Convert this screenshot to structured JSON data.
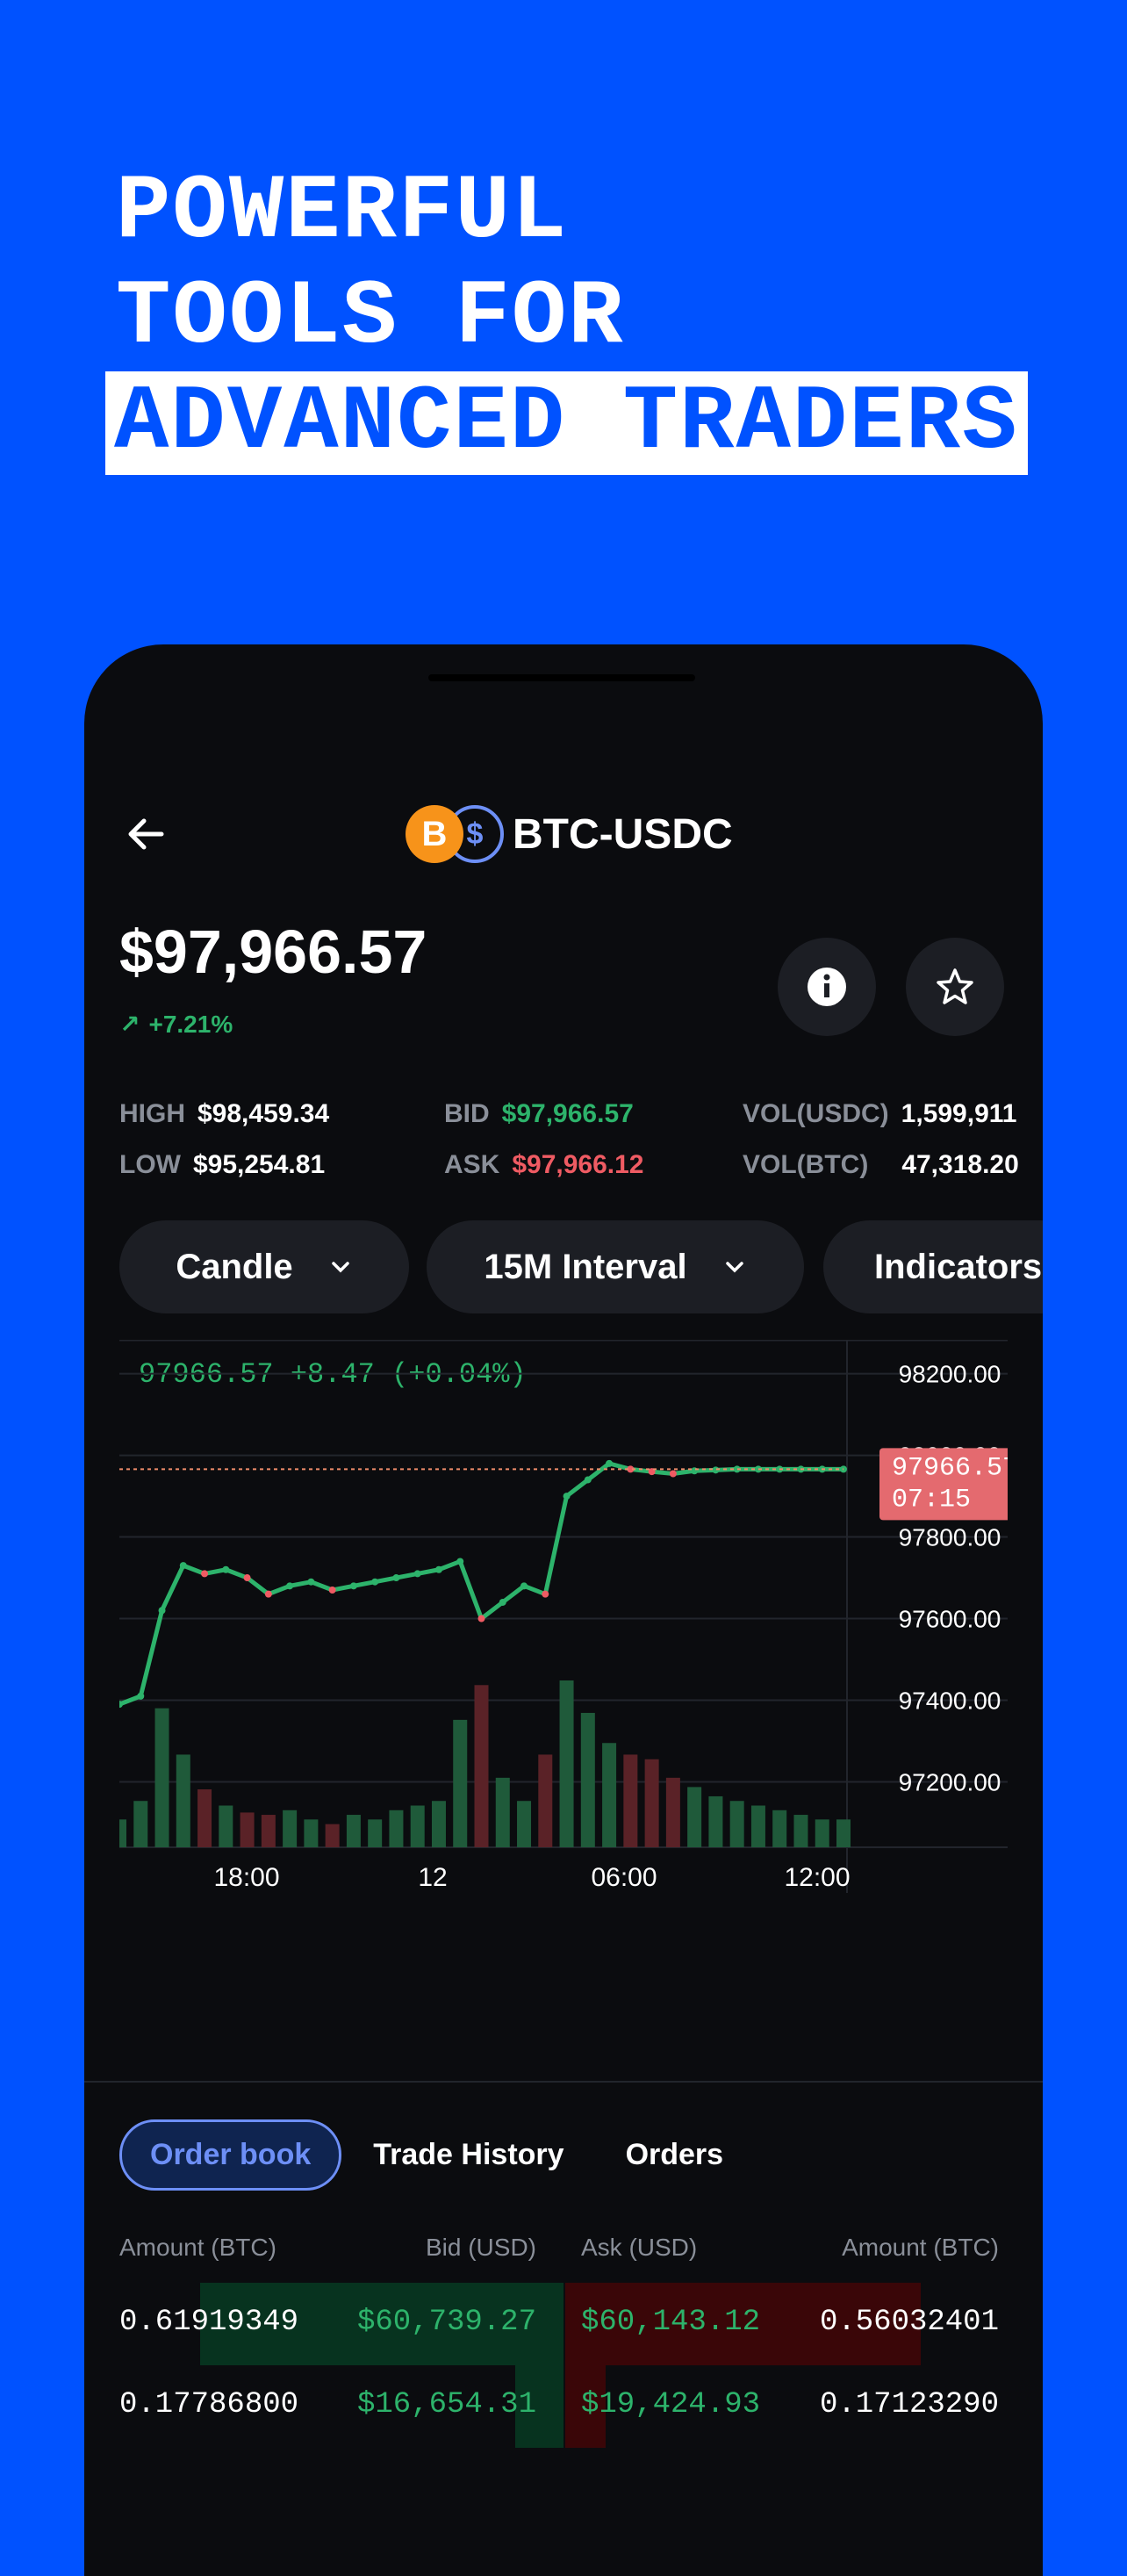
{
  "headline": {
    "line1": "POWERFUL",
    "line2": "TOOLS FOR",
    "line3": "ADVANCED TRADERS"
  },
  "header": {
    "pair": "BTC-USDC",
    "btc_symbol": "B",
    "usd_symbol": "$"
  },
  "price": {
    "value": "$97,966.57",
    "change": "+7.21%",
    "change_arrow": "↗"
  },
  "stats": {
    "high_label": "HIGH",
    "high": "$98,459.34",
    "low_label": "LOW",
    "low": "$95,254.81",
    "bid_label": "BID",
    "bid": "$97,966.57",
    "ask_label": "ASK",
    "ask": "$97,966.12",
    "vol_usdc_label": "VOL(USDC)",
    "vol_usdc": "1,599,911",
    "vol_btc_label": "VOL(BTC)",
    "vol_btc": "47,318.20"
  },
  "controls": {
    "chart_type": "Candle",
    "interval": "15M Interval",
    "indicators": "Indicators"
  },
  "chart_data": {
    "type": "line",
    "summary": "97966.57 +8.47 (+0.04%)",
    "y_ticks": [
      "98200.00",
      "98000.00",
      "97800.00",
      "97600.00",
      "97400.00",
      "97200.00"
    ],
    "x_ticks": [
      "18:00",
      "12",
      "06:00",
      "12:00"
    ],
    "ylim": [
      97100,
      98240
    ],
    "last_price_label": "97966.57",
    "countdown": "07:15",
    "x": [
      0,
      6,
      12,
      18,
      24,
      30,
      36,
      42,
      48,
      54,
      60,
      66,
      72,
      78,
      84,
      90,
      96,
      102,
      108,
      114,
      120,
      126,
      132,
      138,
      144,
      150,
      156,
      162,
      168,
      174,
      180,
      186,
      192,
      198,
      204
    ],
    "values": [
      97390,
      97410,
      97620,
      97730,
      97710,
      97720,
      97700,
      97660,
      97680,
      97690,
      97670,
      97680,
      97690,
      97700,
      97710,
      97720,
      97740,
      97600,
      97640,
      97680,
      97660,
      97900,
      97940,
      97980,
      97966,
      97960,
      97955,
      97962,
      97964,
      97966,
      97966,
      97966,
      97966,
      97966,
      97966
    ],
    "volumes": [
      12,
      20,
      60,
      40,
      25,
      18,
      15,
      14,
      16,
      12,
      10,
      14,
      12,
      16,
      18,
      20,
      55,
      70,
      30,
      20,
      40,
      72,
      58,
      45,
      40,
      38,
      30,
      26,
      22,
      20,
      18,
      16,
      14,
      12,
      12
    ],
    "colors": {
      "up": "#2db36b",
      "down": "#ef5b63",
      "price_line": "#ef8c6a",
      "grid": "#22252c",
      "axis_text": "#ffffff"
    }
  },
  "tabs": {
    "order_book": "Order book",
    "trade_history": "Trade History",
    "orders": "Orders"
  },
  "order_book": {
    "headers": [
      "Amount (BTC)",
      "Bid (USD)",
      "Ask (USD)",
      "Amount (BTC)"
    ],
    "rows": [
      {
        "bid_amount": "0.61919349",
        "bid": "$60,739.27",
        "ask": "$60,143.12",
        "ask_amount": "0.56032401",
        "bid_depth": 0.9,
        "ask_depth": 0.88
      },
      {
        "bid_amount": "0.17786800",
        "bid": "$16,654.31",
        "ask": "$19,424.93",
        "ask_amount": "0.17123290",
        "bid_depth": 0.12,
        "ask_depth": 0.1
      }
    ]
  }
}
